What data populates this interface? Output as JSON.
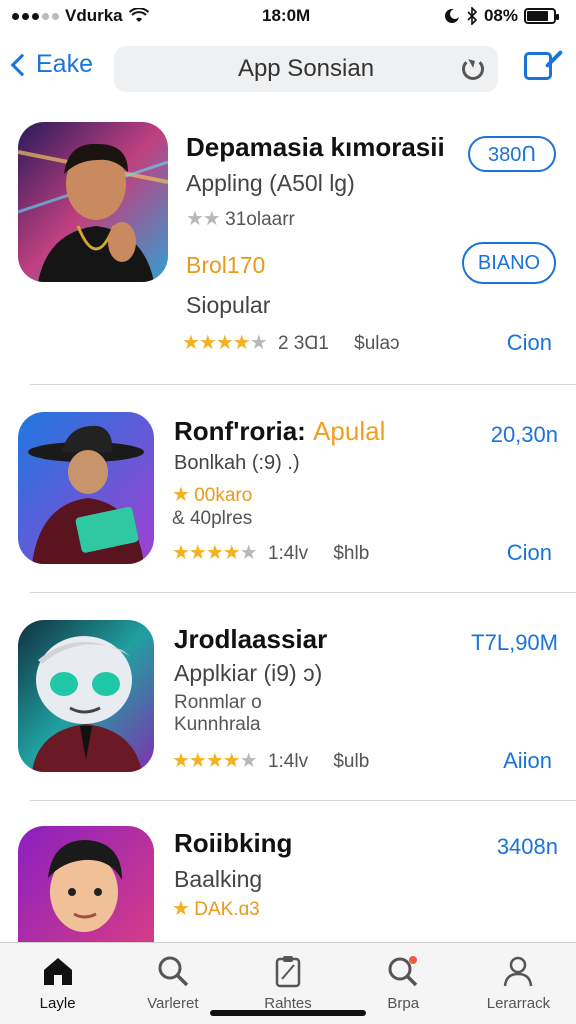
{
  "status": {
    "carrier": "Vdurka",
    "time": "18:0M",
    "battery": "08%",
    "battery_level": 0.8
  },
  "nav": {
    "back_label": "Eake",
    "title": "App Sonsian"
  },
  "apps": [
    {
      "title": "Depamasia kımorasii",
      "subtitle": "Appling (A50l lg)",
      "rating_text": "31olaarr",
      "category": "Brol170",
      "popularity": "Siopular",
      "rating_count": "2 3Ɑ1",
      "size": "$ulaɔ",
      "price": "380Ո",
      "secondary_button": "BIANO",
      "action": "Cion"
    },
    {
      "title": "Ronf'roria:",
      "title_accent": "Apulal",
      "subtitle": "Bonlkah (:9) .)",
      "line1": "00karo",
      "line2": "40plres",
      "rating_count": "1:4lv",
      "size": "$hlb",
      "price": "20,30n",
      "action": "Cion"
    },
    {
      "title": "Jrodlaassiar",
      "subtitle": "Applkiar (i9) ɔ)",
      "line1": "Ronmlar o",
      "line2": "Kunnhrala",
      "rating_count": "1:4lv",
      "size": "$ulb",
      "price": "T7L,90M",
      "action": "Aiion"
    },
    {
      "title": "Roiibking",
      "subtitle": "Baalking",
      "line1": "DAK.ɑ3",
      "price": "3408n"
    }
  ],
  "tabs": [
    {
      "label": "Layle",
      "icon": "home-icon"
    },
    {
      "label": "Varleret",
      "icon": "search-icon"
    },
    {
      "label": "Rahtes",
      "icon": "clipboard-icon"
    },
    {
      "label": "Brpa",
      "icon": "notification-search-icon"
    },
    {
      "label": "Lerarrack",
      "icon": "profile-icon"
    }
  ],
  "colors": {
    "accent": "#1a73d9",
    "star": "#f5b020",
    "orange": "#e89a18"
  }
}
